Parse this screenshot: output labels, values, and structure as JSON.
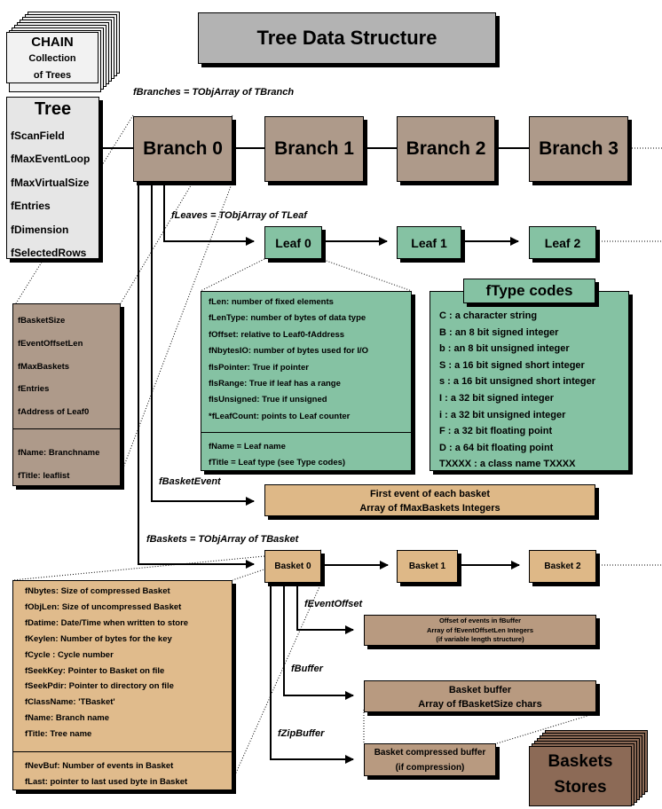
{
  "title": "Tree Data Structure",
  "chain": {
    "title": "CHAIN",
    "line1": "Collection",
    "line2": "of Trees"
  },
  "tree": {
    "title": "Tree",
    "fields": [
      "fScanField",
      "fMaxEventLoop",
      "fMaxVirtualSize",
      "fEntries",
      "fDimension",
      "fSelectedRows"
    ]
  },
  "labels": {
    "branches": "fBranches = TObjArray of TBranch",
    "leaves": "fLeaves = TObjArray of TLeaf",
    "basket_event": "fBasketEvent",
    "baskets": "fBaskets = TObjArray of TBasket",
    "event_offset": "fEventOffset",
    "buffer": "fBuffer",
    "zip_buffer": "fZipBuffer"
  },
  "branches": [
    "Branch 0",
    "Branch 1",
    "Branch 2",
    "Branch 3"
  ],
  "leaves": [
    "Leaf 0",
    "Leaf 1",
    "Leaf 2"
  ],
  "baskets": [
    "Basket 0",
    "Basket 1",
    "Basket 2"
  ],
  "branch_detail": {
    "fields": [
      "fBasketSize",
      "fEventOffsetLen",
      "fMaxBaskets",
      "fEntries",
      "fAddress of Leaf0"
    ],
    "names": [
      "fName: Branchname",
      "fTitle: leaflist"
    ]
  },
  "leaf_detail": {
    "fields": [
      "fLen: number of fixed elements",
      "fLenType: number of bytes of data type",
      "fOffset: relative to Leaf0-fAddress",
      "fNbytesIO: number of bytes used for I/O",
      "fIsPointer: True if pointer",
      "fIsRange: True if leaf has a range",
      "fIsUnsigned: True if unsigned",
      "*fLeafCount: points to Leaf counter"
    ],
    "names": [
      "fName = Leaf name",
      "fTitle = Leaf type (see Type codes)"
    ]
  },
  "type_codes": {
    "title": "fType codes",
    "codes": [
      "C : a character string",
      "B : an 8 bit signed integer",
      "b : an 8 bit unsigned integer",
      "S : a 16 bit signed short integer",
      "s : a 16 bit unsigned short integer",
      "I : a 32 bit signed integer",
      "i : a 32 bit unsigned integer",
      "F : a 32 bit floating point",
      "D : a 64 bit floating point",
      "TXXXX : a class name TXXXX"
    ]
  },
  "basket_event_box": {
    "line1": "First event of each basket",
    "line2": "Array of fMaxBaskets Integers"
  },
  "basket_detail": {
    "fields": [
      "fNbytes: Size of compressed Basket",
      "fObjLen: Size of uncompressed Basket",
      "fDatime: Date/Time when written to store",
      "fKeylen: Number of bytes for the key",
      "fCycle : Cycle number",
      "fSeekKey: Pointer to Basket on file",
      "fSeekPdir: Pointer to directory on file",
      "fClassName: 'TBasket'",
      "fName: Branch name",
      "fTitle: Tree name"
    ],
    "extra": [
      "fNevBuf: Number of events in Basket",
      "fLast: pointer to last used byte in Basket"
    ]
  },
  "event_offset_box": {
    "line1": "Offset of events in fBuffer",
    "line2": "Array of fEventOffsetLen Integers",
    "line3": "(if variable length structure)"
  },
  "buffer_box": {
    "line1": "Basket buffer",
    "line2": "Array of fBasketSize chars"
  },
  "zip_box": {
    "line1": "Basket compressed buffer",
    "line2": "(if compression)"
  },
  "stores": {
    "line1": "Baskets",
    "line2": "Stores"
  },
  "colors": {
    "branch": "#ae9a8a",
    "leaf": "#85c2a3",
    "basket": "#deb887",
    "buffer": "#b89a80",
    "store": "#8c6a56",
    "title_bg": "#b3b3b3"
  }
}
